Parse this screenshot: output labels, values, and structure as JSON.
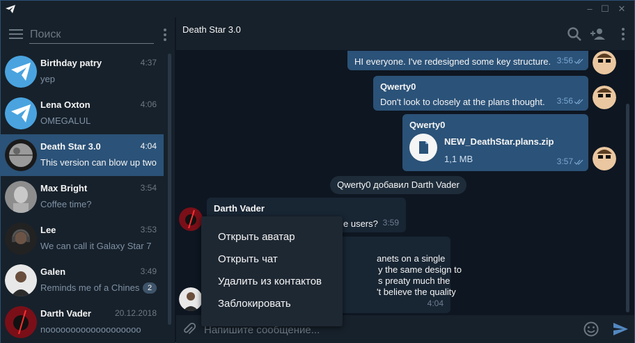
{
  "search": {
    "placeholder": "Поиск"
  },
  "chats": [
    {
      "name": "Birthday patry",
      "time": "4:37",
      "preview": "yep",
      "avatar": "telegram-logo"
    },
    {
      "name": "Lena Oxton",
      "time": "4:06",
      "preview": "OMEGALUL",
      "avatar": "telegram-logo"
    },
    {
      "name": "Death Star 3.0",
      "time": "4:04",
      "preview": "This version can blow up two",
      "avatar": "death-star",
      "active": true
    },
    {
      "name": "Max Bright",
      "time": "3:54",
      "preview": "Coffee time?",
      "avatar": "statue"
    },
    {
      "name": "Lee",
      "time": "3:53",
      "preview": "We can call it Galaxy Star 7",
      "avatar": "headphones-person"
    },
    {
      "name": "Galen",
      "time": "3:49",
      "preview": "Reminds me of a Chinese",
      "badge": "2",
      "avatar": "man-portrait"
    },
    {
      "name": "Darth Vader",
      "time": "20.12.2018",
      "preview": "nooooooooooooooooooo",
      "avatar": "lightsaber"
    }
  ],
  "header": {
    "title": "Death Star 3.0"
  },
  "messages": {
    "m1": {
      "text": "HI everyone. I've redesigned some key structure.",
      "time": "3:56"
    },
    "m2": {
      "sender": "Qwerty0",
      "text": "Don't look to closely at the plans thought.",
      "time": "3:56"
    },
    "m3": {
      "sender": "Qwerty0",
      "file_name": "NEW_DeathStar.plans.zip",
      "file_size": "1,1 MB",
      "time": "3:57"
    },
    "service": "Qwerty0 добавил Darth Vader",
    "m4": {
      "sender": "Darth Vader",
      "text": "e users?",
      "time": "3:59"
    },
    "m5": {
      "line1": "anets on a single",
      "line2": "y the same design to",
      "line3": "s preaty much the",
      "line4": "'t believe the quality",
      "time": "4:04"
    }
  },
  "context_menu": {
    "items": [
      "Открыть аватар",
      "Открыть чат",
      "Удалить из контактов",
      "Заблокировать"
    ]
  },
  "composer": {
    "placeholder": "Напишите сообщение..."
  },
  "colors": {
    "bg": "#0e1621",
    "panel": "#17212b",
    "accent": "#2b5278",
    "incoming": "#182533",
    "send": "#5288c1"
  }
}
